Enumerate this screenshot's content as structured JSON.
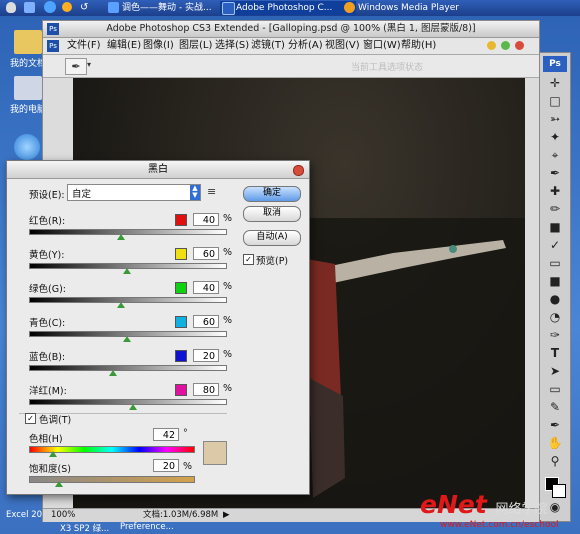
{
  "taskbar": {
    "tabs": [
      {
        "label": "调色——舞动 - 实战..."
      },
      {
        "label": "Adobe Photoshop C..."
      },
      {
        "label": "Windows Media Player"
      }
    ]
  },
  "desktop": {
    "icons": [
      {
        "label": "我的文档"
      },
      {
        "label": "我的电脑"
      }
    ],
    "bottom_item": "Excel 200",
    "bottom_task": "X3 SP2 绿...",
    "bottom_task2": "Preference..."
  },
  "photoshop": {
    "title": "Adobe Photoshop CS3 Extended - [Galloping.psd @ 100% (黑白 1, 图层蒙版/8)]",
    "menus": [
      "文件(F)",
      "编辑(E)",
      "图像(I)",
      "图层(L)",
      "选择(S)",
      "滤镜(T)",
      "分析(A)",
      "视图(V)",
      "窗口(W)",
      "帮助(H)"
    ],
    "options_hint": "当前工具选项状态",
    "status_zoom": "100%",
    "status_doc": "文档:1.03M/6.98M",
    "accent": "#1e5fb8"
  },
  "dialog": {
    "title": "黑白",
    "preset_label": "预设(E):",
    "preset_value": "自定",
    "ok_label": "确定",
    "cancel_label": "取消",
    "auto_label": "自动(A)",
    "preview_label": "预览(P)",
    "percent": "%",
    "sliders": [
      {
        "label": "红色(R):",
        "value": "40",
        "color": "#e01010",
        "level": 0.47
      },
      {
        "label": "黄色(Y):",
        "value": "60",
        "color": "#f0e010",
        "level": 0.5
      },
      {
        "label": "绿色(G):",
        "value": "40",
        "color": "#10d010",
        "level": 0.47
      },
      {
        "label": "青色(C):",
        "value": "60",
        "color": "#10b0e0",
        "level": 0.5
      },
      {
        "label": "蓝色(B):",
        "value": "20",
        "color": "#1010d0",
        "level": 0.43
      },
      {
        "label": "洋红(M):",
        "value": "80",
        "color": "#e010a0",
        "level": 0.53
      }
    ],
    "tint_label": "色调(T)",
    "hue_label": "色相(H)",
    "hue_value": "42",
    "degree": "°",
    "sat_label": "饱和度(S)",
    "sat_value": "20",
    "tint_swatch": "#dcc9a8"
  },
  "watermark": {
    "brand": "eNet",
    "text": "网络学院",
    "url": "www.eNet.com.cn/eschool"
  }
}
